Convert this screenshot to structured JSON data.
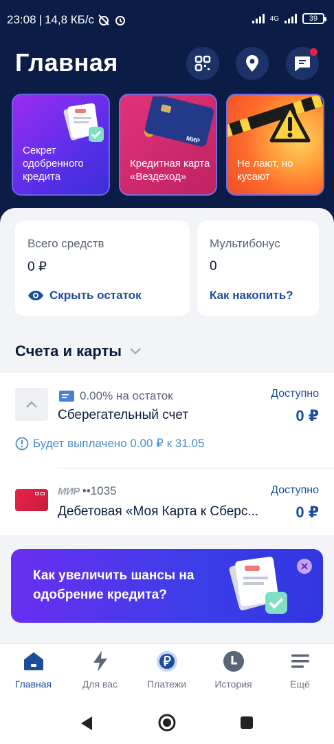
{
  "status_bar": {
    "time": "23:08",
    "speed": "14,8 КБ/с",
    "network": "4G",
    "battery": "39"
  },
  "header": {
    "title": "Главная"
  },
  "stories": [
    {
      "text": "Секрет одобренного кредита"
    },
    {
      "text": "Кредитная карта «Вездеход»"
    },
    {
      "text": "Не лают, но кусают"
    }
  ],
  "balance_card": {
    "label": "Всего средств",
    "value": "0 ₽",
    "action": "Скрыть остаток"
  },
  "bonus_card": {
    "label": "Мультибонус",
    "value": "0",
    "action": "Как накопить?"
  },
  "accounts_section": {
    "title": "Счета и карты"
  },
  "accounts": [
    {
      "subtitle": "0.00% на остаток",
      "name": "Сберегательный счет",
      "available_label": "Доступно",
      "amount": "0 ₽",
      "note": "Будет выплачено 0.00 ₽ к 31.05"
    },
    {
      "card_brand": "МИР",
      "card_mask": "••1035",
      "name": "Дебетовая «Моя Карта к Сберс...",
      "available_label": "Доступно",
      "amount": "0 ₽"
    }
  ],
  "promo": {
    "text": "Как увеличить шансы на одобрение кредита?"
  },
  "tabs": [
    {
      "label": "Главная",
      "icon": "home-icon"
    },
    {
      "label": "Для вас",
      "icon": "lightning-icon"
    },
    {
      "label": "Платежи",
      "icon": "ruble-icon"
    },
    {
      "label": "История",
      "icon": "history-icon"
    },
    {
      "label": "Ещё",
      "icon": "menu-icon"
    }
  ],
  "colors": {
    "header_bg": "#0b1d47",
    "accent": "#1a4d9c",
    "promo": "#4a36ea"
  }
}
